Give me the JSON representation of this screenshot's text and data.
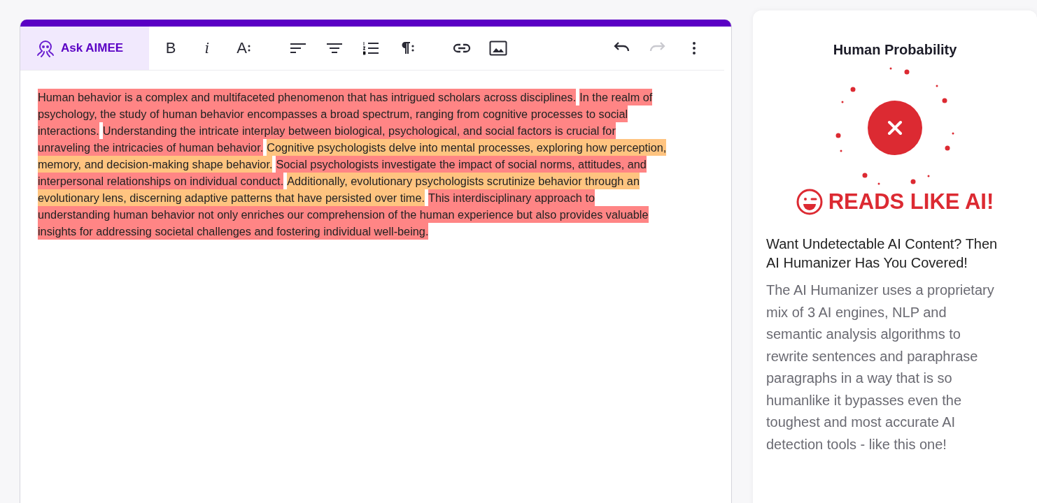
{
  "editor": {
    "assistant_button": {
      "label": "Ask AIMEE"
    },
    "toolbar": [
      {
        "kind": "bold",
        "label": "B",
        "disabled": false
      },
      {
        "kind": "italic",
        "label": "i",
        "disabled": false
      },
      {
        "kind": "font-size",
        "label": "A",
        "disabled": false
      },
      {
        "kind": "align-left",
        "disabled": false
      },
      {
        "kind": "align-center",
        "disabled": false
      },
      {
        "kind": "numbered-list",
        "disabled": false
      },
      {
        "kind": "paragraph",
        "disabled": false
      },
      {
        "kind": "link",
        "disabled": false
      },
      {
        "kind": "image",
        "disabled": false
      },
      {
        "kind": "undo",
        "disabled": false
      },
      {
        "kind": "redo",
        "disabled": true
      },
      {
        "kind": "more",
        "disabled": false
      }
    ],
    "lines": [
      [
        {
          "text": "Human behavior is a complex and multifaceted phenomenon that has intrigued scholars across disciplines.",
          "color": "#ff8585"
        },
        {
          "text": "In the realm of",
          "color": "#ff8585"
        }
      ],
      [
        {
          "text": "psychology, the study of human behavior encompasses a broad spectrum, ranging from cognitive processes to social",
          "color": "#ff8585"
        }
      ],
      [
        {
          "text": "interactions.",
          "color": "#ff8585"
        },
        {
          "text": "Understanding the intricate interplay between biological, psychological, and social factors is crucial for",
          "color": "#ff8585"
        }
      ],
      [
        {
          "text": "unraveling the intricacies of human behavior.",
          "color": "#ff8585"
        },
        {
          "text": "Cognitive psychologists delve into mental processes, exploring how perception,",
          "color": "#ffc480"
        }
      ],
      [
        {
          "text": "memory, and decision-making shape behavior.",
          "color": "#ffc480"
        },
        {
          "text": "Social psychologists investigate the impact of social norms, attitudes, and",
          "color": "#ff8585"
        }
      ],
      [
        {
          "text": "interpersonal relationships on individual conduct.",
          "color": "#ff8585"
        },
        {
          "text": "Additionally, evolutionary psychologists scrutinize behavior through an",
          "color": "#ffc480"
        }
      ],
      [
        {
          "text": "evolutionary lens, discerning adaptive patterns that have persisted over time.",
          "color": "#ffc480"
        },
        {
          "text": "This interdisciplinary approach to",
          "color": "#ff8585"
        }
      ],
      [
        {
          "text": "understanding human behavior not only enriches our comprehension of the human experience but also provides valuable",
          "color": "#ff8585"
        }
      ],
      [
        {
          "text": "insights for addressing societal challenges and fostering individual well-being.",
          "color": "#ff8585"
        }
      ]
    ]
  },
  "result_panel": {
    "title": "Human Probability",
    "verdict": "READS LIKE AI!",
    "promo_heading": "Want Undetectable AI Content? Then AI Humanizer Has You Covered!",
    "promo_text": "The AI Humanizer uses a proprietary mix of 3 AI engines, NLP and semantic analysis algorithms to rewrite sentences and paraphrase paragraphs in a way that is so humanlike it bypasses even the toughest and most accurate AI detection tools - like this one!"
  }
}
